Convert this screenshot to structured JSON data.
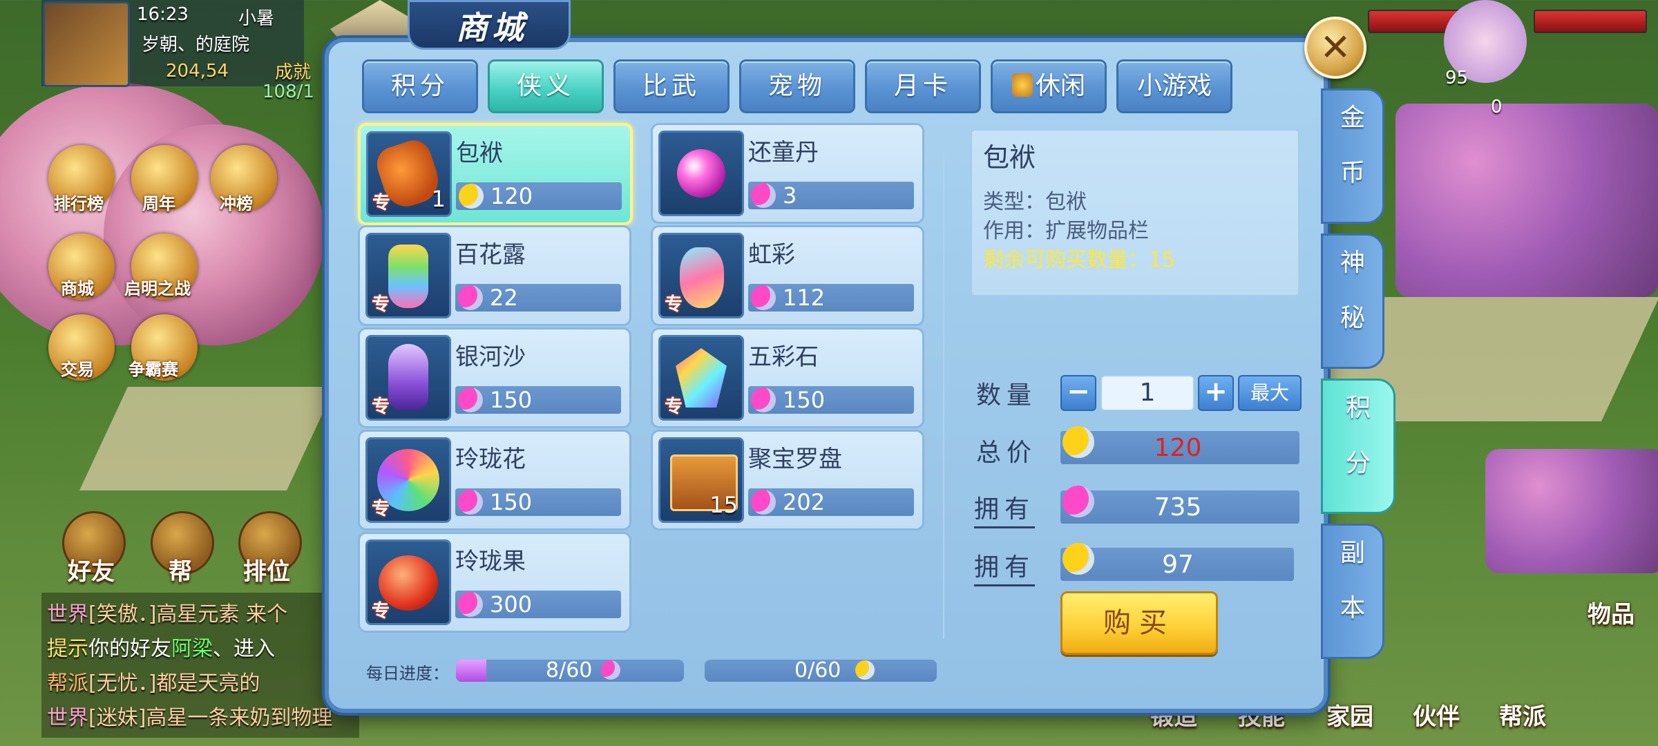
{
  "hud": {
    "time": "16:23",
    "player_name": "小暑",
    "location": "岁朝、的庭院",
    "gold": "204,54",
    "top_left_right_label": "成就",
    "exp": "108/1",
    "right_count_a": "95",
    "right_count_b": "0"
  },
  "left_menu": {
    "items": [
      {
        "label": "排行榜"
      },
      {
        "label": "周年"
      },
      {
        "label": "冲榜"
      },
      {
        "label": "商城"
      },
      {
        "label": "启明之战"
      },
      {
        "label": "交易"
      },
      {
        "label": "争霸赛"
      }
    ],
    "round_buttons": [
      {
        "label": "好友"
      },
      {
        "label": "帮"
      },
      {
        "label": "排位"
      }
    ]
  },
  "chat": {
    "lines": [
      {
        "tag": "世界",
        "text": "[笑傲．]高星元素 来个"
      },
      {
        "tag": "提示",
        "text": "你的好友",
        "highlight": "阿梁",
        "rest": "、进入"
      },
      {
        "tag": "帮派",
        "text": "[无忧．]都是天亮的"
      },
      {
        "tag": "世界",
        "text": "[迷妹]高星一条来奶到物理"
      }
    ]
  },
  "bottom_nav": {
    "items": [
      {
        "label": "锻造"
      },
      {
        "label": "技能"
      },
      {
        "label": "家园"
      },
      {
        "label": "伙伴"
      },
      {
        "label": "帮派"
      }
    ],
    "right_items_label": "物品"
  },
  "shop": {
    "title": "商城",
    "tabs": [
      {
        "label": "积分",
        "active": false
      },
      {
        "label": "侠义",
        "active": true
      },
      {
        "label": "比武",
        "active": false
      },
      {
        "label": "宠物",
        "active": false
      },
      {
        "label": "月卡",
        "active": false
      },
      {
        "label": "休闲",
        "active": false,
        "icon": "gift-box-icon"
      },
      {
        "label": "小游戏",
        "active": false
      }
    ],
    "items": [
      {
        "name": "包袱",
        "price": "120",
        "currency": "gold-moon",
        "exclusive": true,
        "badge": "1",
        "art": "bag",
        "selected": true
      },
      {
        "name": "还童丹",
        "price": "3",
        "currency": "pink-moon",
        "exclusive": false,
        "badge": "",
        "art": "pearl",
        "selected": false
      },
      {
        "name": "百花露",
        "price": "22",
        "currency": "pink-moon",
        "exclusive": true,
        "badge": "",
        "art": "bottle1",
        "selected": false
      },
      {
        "name": "虹彩",
        "price": "112",
        "currency": "pink-moon",
        "exclusive": true,
        "badge": "",
        "art": "bottle2",
        "selected": false
      },
      {
        "name": "银河沙",
        "price": "150",
        "currency": "pink-moon",
        "exclusive": true,
        "badge": "",
        "art": "sand",
        "selected": false
      },
      {
        "name": "五彩石",
        "price": "150",
        "currency": "pink-moon",
        "exclusive": true,
        "badge": "",
        "art": "gem",
        "selected": false
      },
      {
        "name": "玲珑花",
        "price": "150",
        "currency": "pink-moon",
        "exclusive": true,
        "badge": "",
        "art": "flower",
        "selected": false
      },
      {
        "name": "聚宝罗盘",
        "price": "202",
        "currency": "pink-moon",
        "exclusive": false,
        "badge": "15",
        "art": "compass",
        "selected": false
      },
      {
        "name": "玲珑果",
        "price": "300",
        "currency": "pink-moon",
        "exclusive": true,
        "badge": "",
        "art": "fruit",
        "selected": false
      }
    ],
    "exclusive_label": "专",
    "detail": {
      "name": "包袱",
      "type_line": "类型：包袱",
      "effect_line": "作用：扩展物品栏",
      "remaining_line": "剩余可购买数量：15"
    },
    "purchase": {
      "qty_label": "数量",
      "qty_value": "1",
      "minus": "−",
      "plus": "+",
      "max_label": "最大",
      "total_label": "总价",
      "total_value": "120",
      "own_label": "拥有",
      "own_pink": "735",
      "own_gold": "97",
      "buy_label": "购买"
    },
    "progress": {
      "label": "每日进度：",
      "pink_text": "8/60",
      "pink_fraction": 0.133,
      "gold_text": "0/60",
      "gold_fraction": 0.0
    },
    "side_tabs": [
      {
        "label": [
          "金",
          "币"
        ],
        "active": false
      },
      {
        "label": [
          "神",
          "秘"
        ],
        "active": false
      },
      {
        "label": [
          "积",
          "分"
        ],
        "active": true
      },
      {
        "label": [
          "副",
          "本"
        ],
        "active": false
      }
    ],
    "colors": {
      "total_price": "#e0221e",
      "remaining_text": "#ffe838"
    }
  }
}
